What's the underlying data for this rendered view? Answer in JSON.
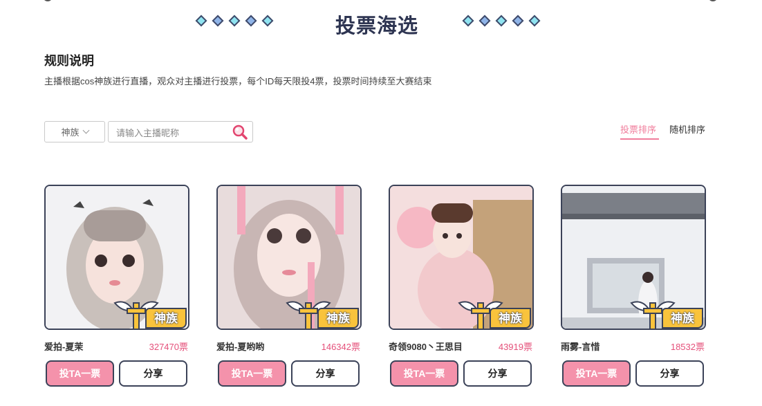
{
  "header": {
    "title": "投票海选",
    "colors": {
      "light_diamond": "#8fe3f0",
      "dark_diamond": "#8fb4e8",
      "title": "#2e3552"
    }
  },
  "rules": {
    "title": "规则说明",
    "text": "主播根据cos神族进行直播，观众对主播进行投票，每个ID每天限投4票，投票时间持续至大赛结束"
  },
  "filter": {
    "clan_select_value": "神族",
    "search_placeholder": "请输入主播昵称",
    "search_icon": "magnifier-icon"
  },
  "sort": {
    "active": "投票排序",
    "options": [
      "投票排序",
      "随机排序"
    ],
    "active_color": "#f07c9b"
  },
  "cards": [
    {
      "name": "爱拍-夏茉",
      "votes": "327470票",
      "badge": "神族",
      "vote_label": "投TA一票",
      "share_label": "分享"
    },
    {
      "name": "爱拍-夏哟哟",
      "votes": "146342票",
      "badge": "神族",
      "vote_label": "投TA一票",
      "share_label": "分享"
    },
    {
      "name": "奇领9080丶王思目",
      "votes": "43919票",
      "badge": "神族",
      "vote_label": "投TA一票",
      "share_label": "分享"
    },
    {
      "name": "雨雾-言惜",
      "votes": "18532票",
      "badge": "神族",
      "vote_label": "投TA一票",
      "share_label": "分享"
    }
  ]
}
